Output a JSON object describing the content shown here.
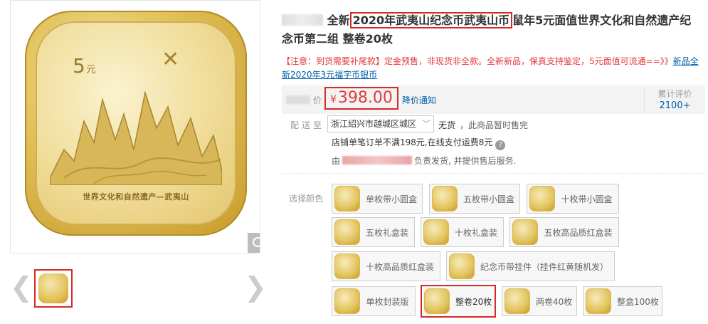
{
  "gallery": {
    "coin_denomination": "5",
    "coin_unit": "元",
    "coin_legend": "世界文化和自然遗产—武夷山",
    "prev_arrow": "❮",
    "next_arrow": "❯",
    "zoom_icon": "zoom-icon"
  },
  "product": {
    "title_prefix": "全新",
    "title_highlight": "2020年武夷山纪念币武夷山币",
    "title_suffix": "鼠年5元面值世界文化和自然遗产纪念币第二组 整卷20枚",
    "notice_text": "【注意：到货需要补尾款】定金预售，非现货非全款。全新新品，保真支持鉴定，5元面值可流通==》》",
    "notice_link": "新品全新2020年3元福字币银币",
    "price_label_suffix": "价",
    "currency": "¥",
    "price": "398.00",
    "price_alert": "降价通知",
    "review_label": "累计评价",
    "review_count": "2100+"
  },
  "shipping": {
    "label": "配送至",
    "region": "浙江绍兴市越城区城区",
    "stock_status": "无货",
    "stock_note": "，此商品暂时售完",
    "freight": "店铺单笔订单不满198元,在线支付运费8元",
    "seller_prefix": "由",
    "seller_suffix": "负责发货, 并提供售后服务."
  },
  "options": {
    "label": "选择颜色",
    "items": [
      {
        "label": "单枚带小圆盒"
      },
      {
        "label": "五枚带小圆盒"
      },
      {
        "label": "十枚带小圆盒"
      },
      {
        "label": "五枚礼盒装"
      },
      {
        "label": "十枚礼盒装"
      },
      {
        "label": "五枚高品质红盒装"
      },
      {
        "label": "十枚高品质红盒装"
      },
      {
        "label": "纪念币带挂件（挂件红黄随机发）"
      },
      {
        "label": "单枚封装版"
      },
      {
        "label": "整卷20枚"
      },
      {
        "label": "两卷40枚"
      },
      {
        "label": "整盒100枚"
      }
    ],
    "selected": "整卷20枚"
  },
  "colors": {
    "accent_red": "#e4393c",
    "highlight_border": "#d42a2a",
    "link_blue": "#005ea7",
    "coin_gold": "#e2c25a"
  }
}
